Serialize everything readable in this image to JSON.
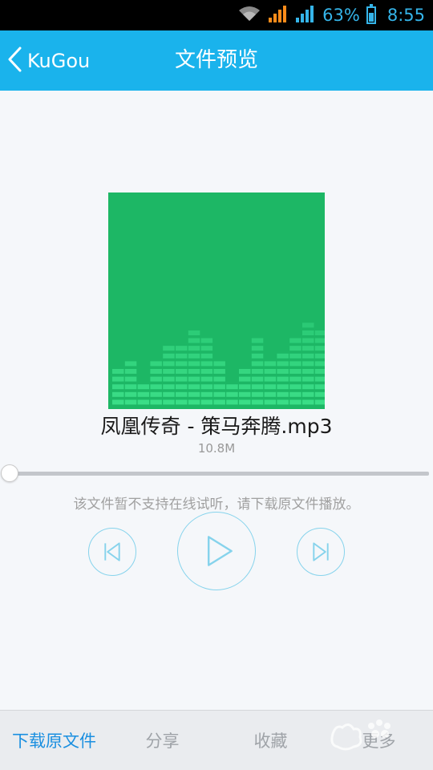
{
  "status": {
    "battery_percent": "63%",
    "time": "8:55",
    "battery_level": 0.63
  },
  "header": {
    "back_label": "KuGou",
    "title": "文件预览"
  },
  "file": {
    "name": "凤凰传奇 - 策马奔腾.mp3",
    "size": "10.8M"
  },
  "player": {
    "progress": 0,
    "notice": "该文件暂不支持在线试听，请下载原文件播放。"
  },
  "bottom_tabs": [
    {
      "label": "下载原文件"
    },
    {
      "label": "分享"
    },
    {
      "label": "收藏"
    },
    {
      "label": "更多"
    }
  ],
  "colors": {
    "accent": "#1ab3ec",
    "art_bg": "#1db765",
    "bar_light": "#3ee28b",
    "status_blue": "#35b5ea",
    "signal_orange": "#ff8c1a"
  }
}
